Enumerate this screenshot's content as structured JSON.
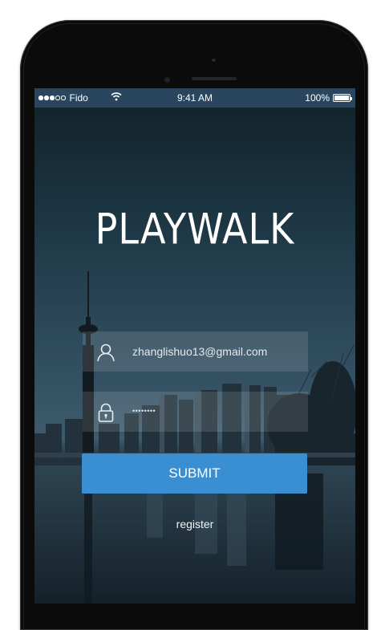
{
  "status_bar": {
    "carrier": "Fido",
    "time": "9:41 AM",
    "battery": "100%",
    "signal_bars_filled": 3,
    "signal_bars_total": 5,
    "battery_level": 1.0
  },
  "app": {
    "logo": "PLAYWALK"
  },
  "login_form": {
    "email": {
      "icon": "user-icon",
      "value": "zhanglishuo13@gmail.com"
    },
    "password": {
      "icon": "lock-icon",
      "masked_value": "••••••••"
    },
    "submit_label": "SUBMIT",
    "register_label": "register"
  },
  "colors": {
    "accent": "#3a8fd2",
    "status_bar": "#2c4a64",
    "background_dark": "#1b2c38"
  }
}
